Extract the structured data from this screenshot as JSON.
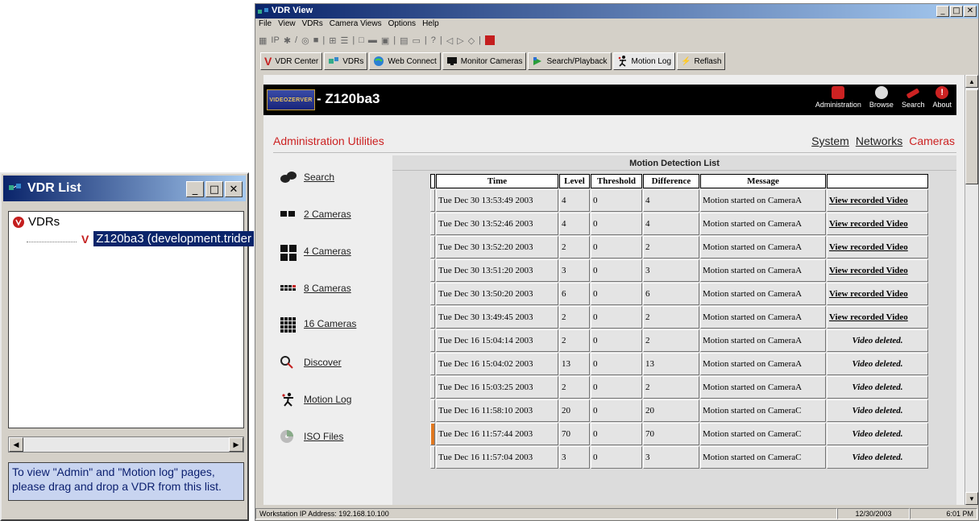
{
  "vdr_list": {
    "title": "VDR List",
    "root_label": "VDRs",
    "child_label": "Z120ba3 (development.trider",
    "hint": "To view \"Admin\" and \"Motion log\" pages, please drag and drop a VDR from this list."
  },
  "app": {
    "title": "VDR View",
    "menu": [
      "File",
      "View",
      "VDRs",
      "Camera Views",
      "Options",
      "Help"
    ],
    "toolbar_text": "IP",
    "tabs": [
      {
        "label": "VDR Center",
        "icon": "v-logo-icon"
      },
      {
        "label": "VDRs",
        "icon": "network-icon"
      },
      {
        "label": "Web Connect",
        "icon": "globe-icon"
      },
      {
        "label": "Monitor Cameras",
        "icon": "monitor-icon"
      },
      {
        "label": "Search/Playback",
        "icon": "search-playback-icon"
      },
      {
        "label": "Motion Log",
        "icon": "running-man-icon"
      },
      {
        "label": "Reflash",
        "icon": "lightning-icon"
      }
    ],
    "status": {
      "ip": "Workstation IP Address: 192.168.10.100",
      "date": "12/30/2003",
      "time": "6:01 PM"
    }
  },
  "page": {
    "vdr_name": "- Z120ba3",
    "logo_text": "VIDEOZERVER",
    "top_icons": [
      {
        "label": "Administration",
        "icon": "admin-icon",
        "color": "#cc2222"
      },
      {
        "label": "Browse",
        "icon": "browse-icon",
        "color": "#dddddd"
      },
      {
        "label": "Search",
        "icon": "search-icon",
        "color": "#cc2222"
      },
      {
        "label": "About",
        "icon": "about-icon",
        "color": "#cc2222"
      }
    ],
    "header_title": "Administration Utilities",
    "header_links": [
      "System",
      "Networks",
      "Cameras"
    ],
    "nav": [
      "Search",
      "2 Cameras",
      "4 Cameras",
      "8 Cameras",
      "16 Cameras",
      "Discover",
      "Motion Log",
      "ISO Files"
    ],
    "table": {
      "caption": "Motion Detection List",
      "columns": [
        "Time",
        "Level",
        "Threshold",
        "Difference",
        "Message",
        ""
      ],
      "rows": [
        {
          "time": "Tue Dec 30 13:53:49 2003",
          "level": "4",
          "threshold": "0",
          "difference": "4",
          "message": "Motion started on CameraA",
          "action": "View recorded Video",
          "hot": false
        },
        {
          "time": "Tue Dec 30 13:52:46 2003",
          "level": "4",
          "threshold": "0",
          "difference": "4",
          "message": "Motion started on CameraA",
          "action": "View recorded Video",
          "hot": false
        },
        {
          "time": "Tue Dec 30 13:52:20 2003",
          "level": "2",
          "threshold": "0",
          "difference": "2",
          "message": "Motion started on CameraA",
          "action": "View recorded Video",
          "hot": false
        },
        {
          "time": "Tue Dec 30 13:51:20 2003",
          "level": "3",
          "threshold": "0",
          "difference": "3",
          "message": "Motion started on CameraA",
          "action": "View recorded Video",
          "hot": false
        },
        {
          "time": "Tue Dec 30 13:50:20 2003",
          "level": "6",
          "threshold": "0",
          "difference": "6",
          "message": "Motion started on CameraA",
          "action": "View recorded Video",
          "hot": false
        },
        {
          "time": "Tue Dec 30 13:49:45 2003",
          "level": "2",
          "threshold": "0",
          "difference": "2",
          "message": "Motion started on CameraA",
          "action": "View recorded Video",
          "hot": false
        },
        {
          "time": "Tue Dec 16 15:04:14 2003",
          "level": "2",
          "threshold": "0",
          "difference": "2",
          "message": "Motion started on CameraA",
          "action": "Video deleted.",
          "hot": false
        },
        {
          "time": "Tue Dec 16 15:04:02 2003",
          "level": "13",
          "threshold": "0",
          "difference": "13",
          "message": "Motion started on CameraA",
          "action": "Video deleted.",
          "hot": false
        },
        {
          "time": "Tue Dec 16 15:03:25 2003",
          "level": "2",
          "threshold": "0",
          "difference": "2",
          "message": "Motion started on CameraA",
          "action": "Video deleted.",
          "hot": false
        },
        {
          "time": "Tue Dec 16 11:58:10 2003",
          "level": "20",
          "threshold": "0",
          "difference": "20",
          "message": "Motion started on CameraC",
          "action": "Video deleted.",
          "hot": false
        },
        {
          "time": "Tue Dec 16 11:57:44 2003",
          "level": "70",
          "threshold": "0",
          "difference": "70",
          "message": "Motion started on CameraC",
          "action": "Video deleted.",
          "hot": true
        },
        {
          "time": "Tue Dec 16 11:57:04 2003",
          "level": "3",
          "threshold": "0",
          "difference": "3",
          "message": "Motion started on CameraC",
          "action": "Video deleted.",
          "hot": false
        }
      ]
    }
  }
}
